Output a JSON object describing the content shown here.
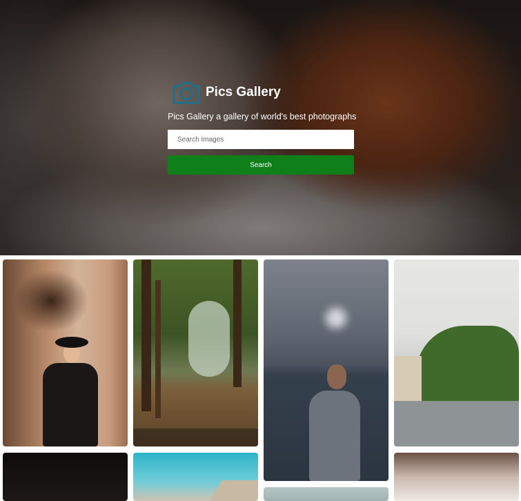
{
  "app": {
    "title": "Pics Gallery",
    "tagline": "Pics Gallery a gallery of world's best photographs"
  },
  "search": {
    "placeholder": "Search Images",
    "button_label": "Search"
  },
  "colors": {
    "accent": "#0f7f1a",
    "logo": "#1f6f8b"
  },
  "icons": {
    "brand": "camera-icon"
  },
  "gallery": {
    "photos": [
      {
        "subject": "man-in-hat-cave"
      },
      {
        "subject": "pine-forest"
      },
      {
        "subject": "man-by-sea"
      },
      {
        "subject": "ivy-covered-house"
      },
      {
        "subject": "dark-photo"
      },
      {
        "subject": "blue-sky-building"
      },
      {
        "subject": "sea-partial"
      },
      {
        "subject": "white-fabric"
      }
    ]
  }
}
